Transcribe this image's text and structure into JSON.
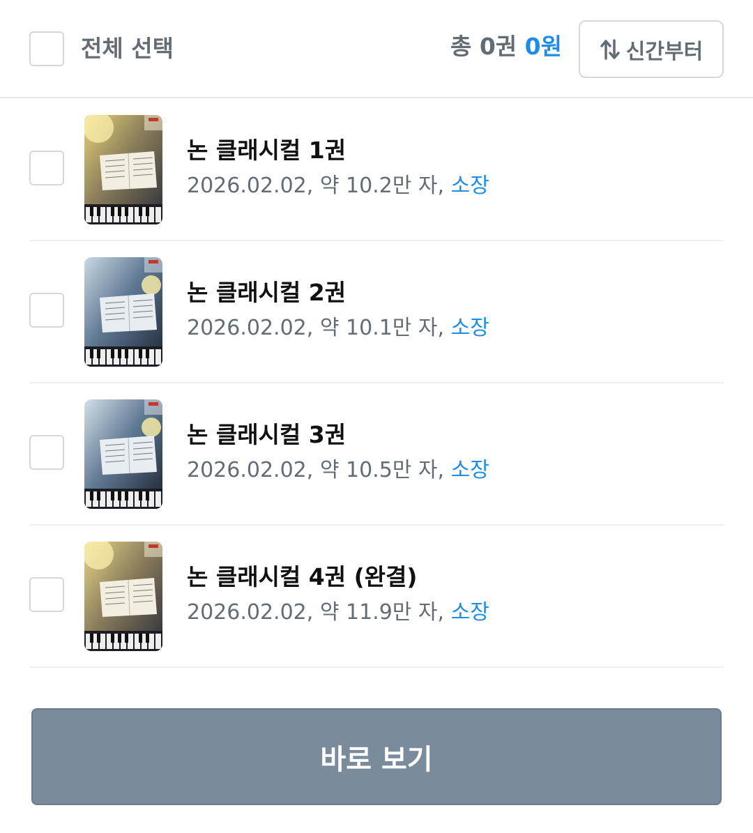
{
  "header": {
    "select_all_label": "전체 선택",
    "summary_prefix": "총 0권",
    "summary_price": "0원",
    "sort_label": "신간부터",
    "sort_icon": "sort-arrows-icon"
  },
  "books": [
    {
      "title": "논 클래시컬 1권",
      "date": "2026.02.02, ",
      "length": "약 10.2만 자, ",
      "status": "소장",
      "cover_tone": "warm"
    },
    {
      "title": "논 클래시컬 2권",
      "date": "2026.02.02, ",
      "length": "약 10.1만 자, ",
      "status": "소장",
      "cover_tone": "cool"
    },
    {
      "title": "논 클래시컬 3권",
      "date": "2026.02.02, ",
      "length": "약 10.5만 자, ",
      "status": "소장",
      "cover_tone": "cool"
    },
    {
      "title": "논 클래시컬 4권 (완결)",
      "date": "2026.02.02, ",
      "length": "약 11.9만 자, ",
      "status": "소장",
      "cover_tone": "warm"
    }
  ],
  "footer": {
    "view_button_label": "바로 보기"
  },
  "colors": {
    "accent_blue": "#1f8ce6",
    "button_gray": "#7a8b9c",
    "text_gray": "#636c73"
  }
}
